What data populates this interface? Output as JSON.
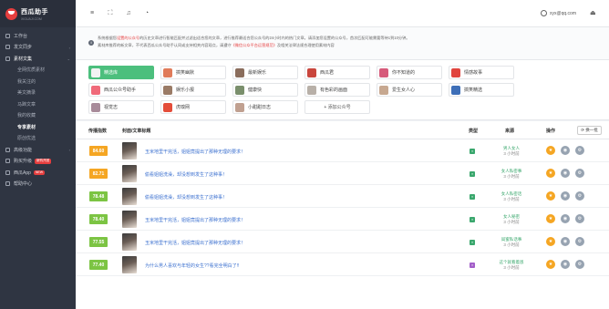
{
  "brand": {
    "name": "西瓜助手",
    "domain": "XIGUAJI.COM"
  },
  "nav": {
    "workbench": "工作台",
    "publish": "发文同步",
    "materials": "素材文集",
    "sub_items": [
      "全网优质素材",
      "我关注的",
      "美文摘录",
      "马蹄文章",
      "我的收藏",
      "专享素材",
      "原创优选"
    ],
    "analytics": "高级功能",
    "purchase": "购买升级",
    "purchase_badge": "新购开团",
    "app": "西瓜App",
    "app_badge": "NEW",
    "help": "帮助中心"
  },
  "topbar": {
    "user": "xyx@qq.com"
  },
  "notice": {
    "line1_pre": "系统根据您",
    "line1_hl": "设置的公众号",
    "line1_post": "的历史文章进行智能匹配并过滤出适合您的文章，进行推荐最适合您公众号的24小时内的热门文章。请添加您设置的公众号，首次匹配可能需要等待1到10分钟。",
    "line2_pre": "素材库推荐的新文章，不代表西瓜公众号助手认同或支持相关内容观点，请遵守",
    "line2_hl": "《微信公众平台运营规范》",
    "line2_post": "及相关法律法规合理使用素材内容"
  },
  "categories": [
    {
      "label": "精选库",
      "active": true
    },
    {
      "label": "搞笑幽默"
    },
    {
      "label": "最新娱乐"
    },
    {
      "label": "西瓜君"
    },
    {
      "label": "你不知道的"
    },
    {
      "label": "情感故事"
    },
    {
      "label": "西瓜公众号助手"
    },
    {
      "label": "娱乐小报"
    },
    {
      "label": "健康快"
    },
    {
      "label": "有色彩的画面"
    },
    {
      "label": "爱生女人心"
    },
    {
      "label": "搞笑精选"
    },
    {
      "label": "视觉志"
    },
    {
      "label": "虎嗅网"
    },
    {
      "label": "小甜甜日志"
    },
    {
      "label": "+ 添加公众号",
      "add": true
    }
  ],
  "table": {
    "headers": {
      "score": "传播指数",
      "cover": "封面/文章标题",
      "type": "类型",
      "source": "来源",
      "ops": "操作"
    },
    "refresh": "换一批",
    "rows": [
      {
        "score": "84.60",
        "color": "#f5a623",
        "title": "玉米地里干完活，姐姐竟提出了那种无理的要求！",
        "type_color": "#3aa76d",
        "source": "男人女人",
        "time": "3 小时前"
      },
      {
        "score": "82.71",
        "color": "#f5a623",
        "title": "偷看姐姐洗澡，却没想到发生了这种事！",
        "type_color": "#3aa76d",
        "source": "女人私密事",
        "time": "3 小时前"
      },
      {
        "score": "78.48",
        "color": "#7cc443",
        "title": "偷看姐姐洗澡，却没想到发生了这种事！",
        "type_color": "#3aa76d",
        "source": "女人私密话",
        "time": "3 小时前"
      },
      {
        "score": "78.40",
        "color": "#7cc443",
        "title": "玉米地里干完活，姐姐竟提出了那种无理的要求！",
        "type_color": "#3aa76d",
        "source": "女人秘密",
        "time": "3 小时前"
      },
      {
        "score": "77.55",
        "color": "#7cc443",
        "title": "玉米地里干完活，姐姐竟提出了那种无理的要求！",
        "type_color": "#3aa76d",
        "source": "闺蜜私话事",
        "time": "3 小时前"
      },
      {
        "score": "77.40",
        "color": "#7cc443",
        "title": "为什么男人喜欢与年轻的女生??看完全明白了!!",
        "type_color": "#a35fc9",
        "source": "这个就看着恩",
        "time": "3 小时前"
      }
    ]
  }
}
